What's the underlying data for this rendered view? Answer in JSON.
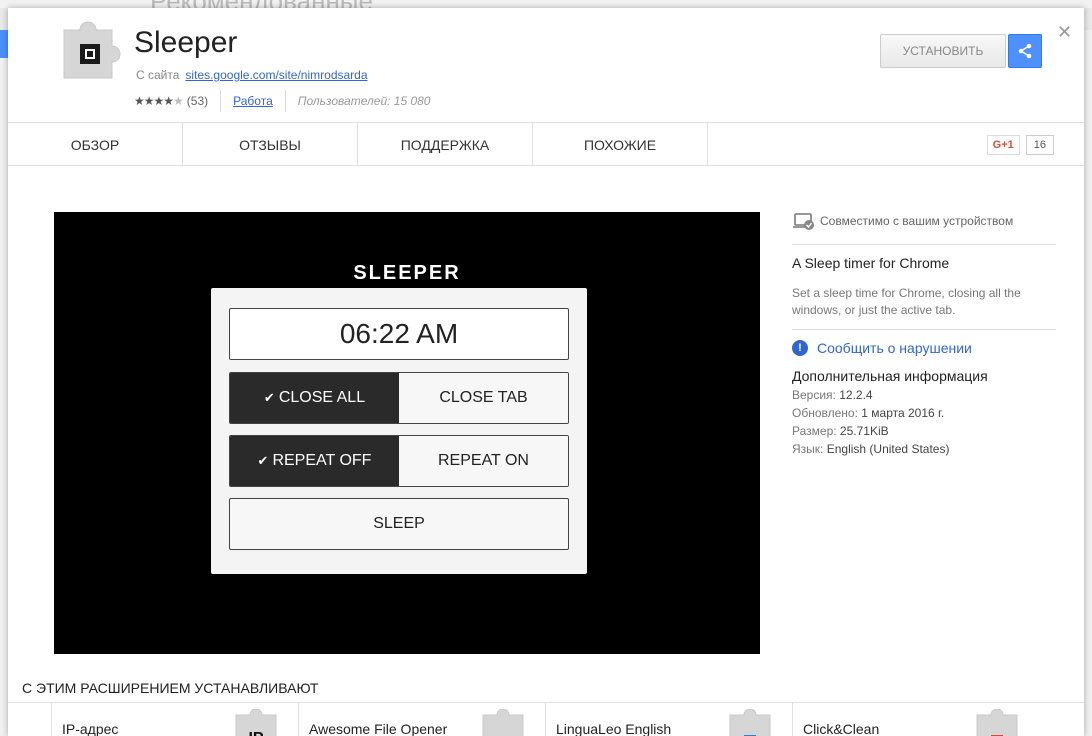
{
  "background": {
    "heading": "Рекомендованные"
  },
  "app": {
    "title": "Sleeper",
    "from_site_prefix": "С сайта",
    "site_link": "sites.google.com/site/nimrodsarda",
    "rating_stars": 4,
    "rating_count": "(53)",
    "category": "Работа",
    "users": "Пользователей: 15 080"
  },
  "actions": {
    "install_label": "УСТАНОВИТЬ",
    "share_icon": "share-icon",
    "close_icon": "close-icon"
  },
  "tabs": [
    {
      "label": "ОБЗОР",
      "active": true
    },
    {
      "label": "ОТЗЫВЫ",
      "active": false
    },
    {
      "label": "ПОДДЕРЖКА",
      "active": false
    },
    {
      "label": "ПОХОЖИЕ",
      "active": false
    }
  ],
  "gplus": {
    "label": "G+1",
    "count": "16"
  },
  "screenshot": {
    "title": "SLEEPER",
    "time": "06:22 AM",
    "close_all": "CLOSE ALL",
    "close_tab": "CLOSE TAB",
    "repeat_off": "REPEAT OFF",
    "repeat_on": "REPEAT ON",
    "sleep": "SLEEP",
    "check_glyph": "✔"
  },
  "sidebar": {
    "compat": "Совместимо с вашим устройством",
    "title": "A Sleep timer for Chrome",
    "description": "Set a sleep time for Chrome, closing all the windows, or just the active tab.",
    "report": "Сообщить о нарушении",
    "info_title": "Дополнительная информация",
    "info": [
      {
        "label": "Версия:",
        "value": "12.2.4"
      },
      {
        "label": "Обновлено:",
        "value": "1 марта 2016 г."
      },
      {
        "label": "Размер:",
        "value": "25.71KiB"
      },
      {
        "label": "Язык:",
        "value": "English (United States)"
      }
    ]
  },
  "related": {
    "title": "С ЭТИМ РАСШИРЕНИЕМ УСТАНАВЛИВАЮТ",
    "items": [
      {
        "name": "IP-адрес",
        "icon_text": "IP"
      },
      {
        "name": "Awesome File Opener"
      },
      {
        "name": "LinguaLeo English"
      },
      {
        "name": "Click&Clean"
      }
    ]
  },
  "colors": {
    "accent": "#4d90fe",
    "link": "#3366cc",
    "gplus": "#dd4b39"
  }
}
